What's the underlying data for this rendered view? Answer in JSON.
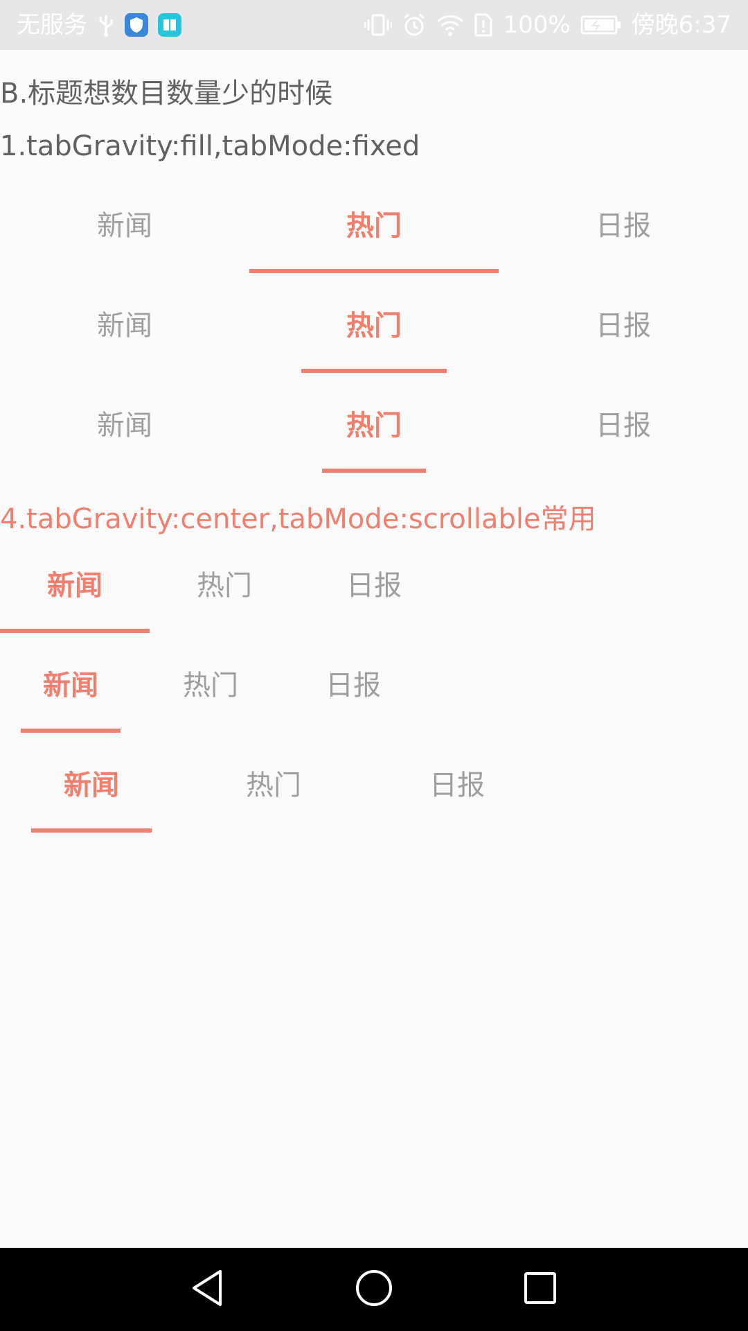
{
  "status_bar": {
    "carrier": "无服务",
    "battery": "100%",
    "time": "傍晚6:37"
  },
  "sections": {
    "header_b": "B.标题想数目数量少的时候",
    "header_1": "1.tabGravity:fill,tabMode:fixed",
    "header_4": "4.tabGravity:center,tabMode:scrollable常用"
  },
  "tabs": {
    "news": "新闻",
    "hot": "热门",
    "daily": "日报"
  },
  "tab_groups": [
    {
      "labels": [
        "新闻",
        "热门",
        "日报"
      ],
      "selected": 1
    },
    {
      "labels": [
        "新闻",
        "热门",
        "日报"
      ],
      "selected": 1
    },
    {
      "labels": [
        "新闻",
        "热门",
        "日报"
      ],
      "selected": 1
    },
    {
      "labels": [
        "新闻",
        "热门",
        "日报"
      ],
      "selected": 0
    },
    {
      "labels": [
        "新闻",
        "热门",
        "日报"
      ],
      "selected": 0
    },
    {
      "labels": [
        "新闻",
        "热门",
        "日报"
      ],
      "selected": 0
    }
  ],
  "colors": {
    "accent": "#ef7f6e",
    "tab_text": "#9e9e9e",
    "title_text": "#616161",
    "background": "#fafafa"
  },
  "icons": {
    "usb": "usb-icon",
    "security_app": "shield-app-icon",
    "reader_app": "book-app-icon",
    "vibrate": "vibrate-icon",
    "alarm": "alarm-icon",
    "wifi": "wifi-icon",
    "sim": "sim-alert-icon",
    "battery": "battery-icon",
    "back": "back-icon",
    "home": "home-icon",
    "recents": "recents-icon"
  }
}
